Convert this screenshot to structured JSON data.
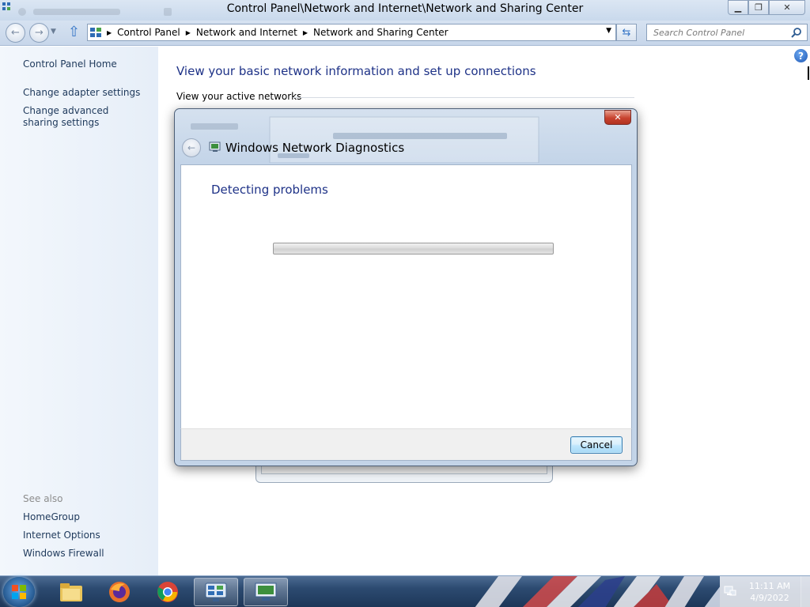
{
  "window": {
    "title": "Control Panel\\Network and Internet\\Network and Sharing Center"
  },
  "address": {
    "crumbs": [
      "Control Panel",
      "Network and Internet",
      "Network and Sharing Center"
    ]
  },
  "search": {
    "placeholder": "Search Control Panel"
  },
  "left_pane": {
    "home": "Control Panel Home",
    "links": [
      "Change adapter settings",
      "Change advanced sharing settings"
    ],
    "see_also_label": "See also",
    "see_also": [
      "HomeGroup",
      "Internet Options",
      "Windows Firewall"
    ]
  },
  "main": {
    "heading": "View your basic network information and set up connections",
    "section_label": "View your active networks"
  },
  "dialog": {
    "title": "Windows Network Diagnostics",
    "status": "Detecting problems",
    "cancel_label": "Cancel",
    "progress": 0
  },
  "taskbar": {
    "time": "11:11 AM",
    "date": "4/9/2022"
  },
  "colors": {
    "link": "#1e395b",
    "heading": "#1e3287",
    "dialog_close": "#c8432f"
  }
}
